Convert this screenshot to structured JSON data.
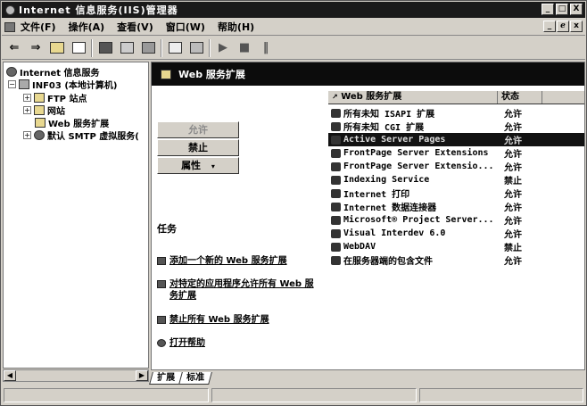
{
  "window": {
    "title": "Internet 信息服务(IIS)管理器",
    "controls": [
      "_",
      "□",
      "X"
    ]
  },
  "menu": {
    "items": [
      "文件(F)",
      "操作(A)",
      "查看(V)",
      "窗口(W)",
      "帮助(H)"
    ],
    "mdi_controls": [
      "_",
      "ℯ",
      "x"
    ]
  },
  "toolbar": {
    "icons": [
      "back-arrow-icon",
      "forward-arrow-icon",
      "up-folder-icon",
      "show-tree-icon",
      "properties-icon",
      "refresh-icon",
      "export-icon",
      "help-icon",
      "console-icon",
      "play-icon",
      "stop-icon",
      "pause-icon"
    ]
  },
  "tree": {
    "root": "Internet 信息服务",
    "server": "INF03 (本地计算机)",
    "children": [
      "FTP 站点",
      "网站",
      "Web 服务扩展",
      "默认 SMTP 虚拟服务("
    ]
  },
  "header": {
    "title": "Web 服务扩展"
  },
  "taskpane": {
    "buttons": {
      "allow": "允许",
      "prohibit": "禁止",
      "properties": "属性"
    },
    "properties_caret": "▾",
    "tasks_label": "任务",
    "links": [
      "添加一个新的 Web 服务扩展",
      "对特定的应用程序允许所有 Web 服务扩展",
      "禁止所有 Web 服务扩展",
      "打开帮助"
    ]
  },
  "list": {
    "columns": [
      "Web 服务扩展",
      "状态"
    ],
    "rows": [
      {
        "name": "所有未知 ISAPI 扩展",
        "status": "允许"
      },
      {
        "name": "所有未知 CGI 扩展",
        "status": "允许"
      },
      {
        "name": "Active Server Pages",
        "status": "允许"
      },
      {
        "name": "FrontPage Server Extensions",
        "status": "允许"
      },
      {
        "name": "FrontPage Server Extensio...",
        "status": "允许"
      },
      {
        "name": "Indexing Service",
        "status": "禁止"
      },
      {
        "name": "Internet 打印",
        "status": "允许"
      },
      {
        "name": "Internet 数据连接器",
        "status": "允许"
      },
      {
        "name": "Microsoft® Project Server...",
        "status": "允许"
      },
      {
        "name": "Visual Interdev 6.0",
        "status": "允许"
      },
      {
        "name": "WebDAV",
        "status": "禁止"
      },
      {
        "name": "在服务器端的包含文件",
        "status": "允许"
      }
    ]
  },
  "tabs": [
    "扩展",
    "标准"
  ]
}
